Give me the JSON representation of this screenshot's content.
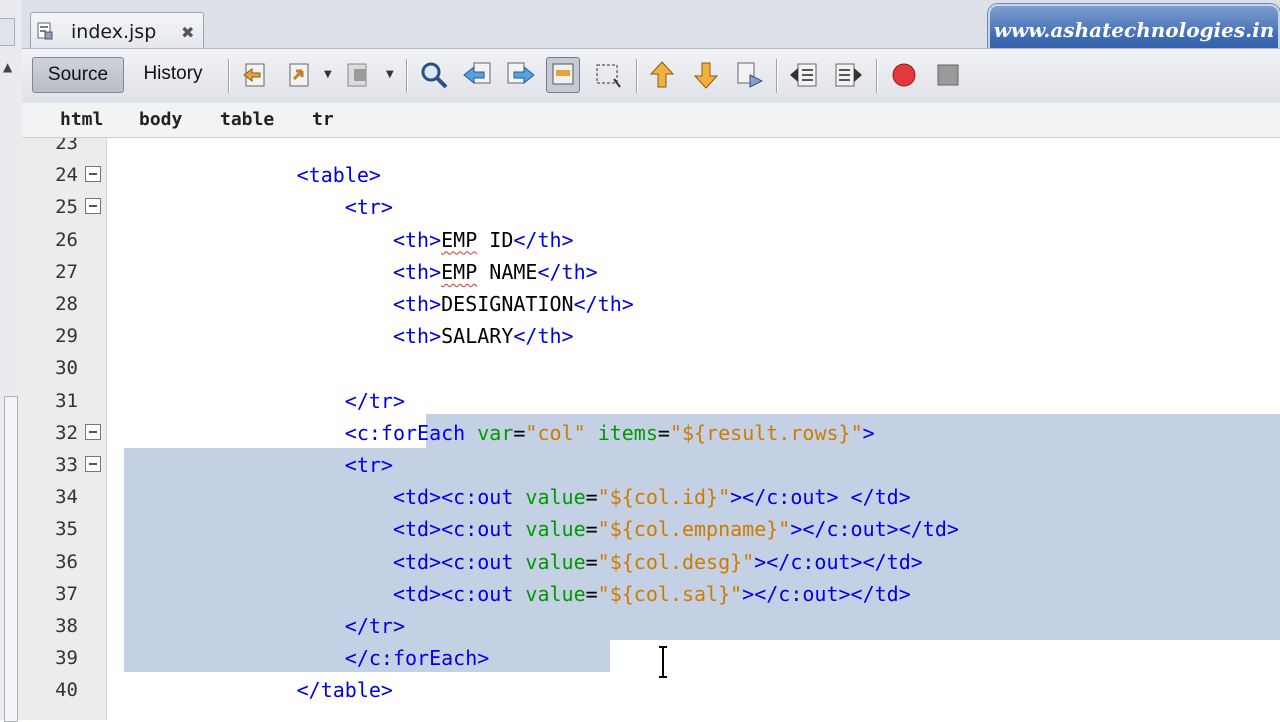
{
  "file_tab": {
    "name": "index.jsp",
    "close_icon": "close-icon"
  },
  "banner": {
    "text": "www.ashatechnologies.in",
    "color": "#3e6bb3"
  },
  "toolbar": {
    "source_label": "Source",
    "history_label": "History"
  },
  "breadcrumbs": [
    "html",
    "body",
    "table",
    "tr"
  ],
  "colors": {
    "tag": "#0000e6",
    "attribute": "#009900",
    "value": "#ce7b00",
    "selection": "#c4d0e4"
  },
  "lines": [
    {
      "n": "23",
      "indent": 0,
      "fold": false,
      "segs": []
    },
    {
      "n": "24",
      "indent": 16,
      "fold": true,
      "segs": [
        {
          "c": "tag",
          "t": "<table>"
        }
      ]
    },
    {
      "n": "25",
      "indent": 20,
      "fold": true,
      "segs": [
        {
          "c": "tag",
          "t": "<tr>"
        }
      ]
    },
    {
      "n": "26",
      "indent": 24,
      "fold": false,
      "segs": [
        {
          "c": "tag",
          "t": "<th>"
        },
        {
          "c": "txt sq",
          "t": "EMP"
        },
        {
          "c": "txt",
          "t": " ID"
        },
        {
          "c": "tag",
          "t": "</th>"
        }
      ]
    },
    {
      "n": "27",
      "indent": 24,
      "fold": false,
      "segs": [
        {
          "c": "tag",
          "t": "<th>"
        },
        {
          "c": "txt sq",
          "t": "EMP"
        },
        {
          "c": "txt",
          "t": " NAME"
        },
        {
          "c": "tag",
          "t": "</th>"
        }
      ]
    },
    {
      "n": "28",
      "indent": 24,
      "fold": false,
      "segs": [
        {
          "c": "tag",
          "t": "<th>"
        },
        {
          "c": "txt",
          "t": "DESIGNATION"
        },
        {
          "c": "tag",
          "t": "</th>"
        }
      ]
    },
    {
      "n": "29",
      "indent": 24,
      "fold": false,
      "segs": [
        {
          "c": "tag",
          "t": "<th>"
        },
        {
          "c": "txt",
          "t": "SALARY"
        },
        {
          "c": "tag",
          "t": "</th>"
        }
      ]
    },
    {
      "n": "30",
      "indent": 0,
      "fold": false,
      "segs": []
    },
    {
      "n": "31",
      "indent": 20,
      "fold": false,
      "segs": [
        {
          "c": "tag",
          "t": "</tr>"
        }
      ]
    },
    {
      "n": "32",
      "indent": 20,
      "fold": true,
      "segs": [
        {
          "c": "tag",
          "t": "<c:forEach "
        },
        {
          "c": "attr",
          "t": "var"
        },
        {
          "c": "txt",
          "t": "="
        },
        {
          "c": "val",
          "t": "\"col\""
        },
        {
          "c": "txt",
          "t": " "
        },
        {
          "c": "attr",
          "t": "items"
        },
        {
          "c": "txt",
          "t": "="
        },
        {
          "c": "val",
          "t": "\"${result.rows}\""
        },
        {
          "c": "tag",
          "t": ">"
        }
      ]
    },
    {
      "n": "33",
      "indent": 20,
      "fold": true,
      "segs": [
        {
          "c": "tag",
          "t": "<tr>"
        }
      ]
    },
    {
      "n": "34",
      "indent": 24,
      "fold": false,
      "segs": [
        {
          "c": "tag",
          "t": "<td><c:out "
        },
        {
          "c": "attr",
          "t": "value"
        },
        {
          "c": "txt",
          "t": "="
        },
        {
          "c": "val",
          "t": "\"${col.id}\""
        },
        {
          "c": "tag",
          "t": "></c:out> </td>"
        }
      ]
    },
    {
      "n": "35",
      "indent": 24,
      "fold": false,
      "segs": [
        {
          "c": "tag",
          "t": "<td><c:out "
        },
        {
          "c": "attr",
          "t": "value"
        },
        {
          "c": "txt",
          "t": "="
        },
        {
          "c": "val",
          "t": "\"${col.empname}\""
        },
        {
          "c": "tag",
          "t": "></c:out></td>"
        }
      ]
    },
    {
      "n": "36",
      "indent": 24,
      "fold": false,
      "segs": [
        {
          "c": "tag",
          "t": "<td><c:out "
        },
        {
          "c": "attr",
          "t": "value"
        },
        {
          "c": "txt",
          "t": "="
        },
        {
          "c": "val",
          "t": "\"${col.desg}\""
        },
        {
          "c": "tag",
          "t": "></c:out></td>"
        }
      ]
    },
    {
      "n": "37",
      "indent": 24,
      "fold": false,
      "segs": [
        {
          "c": "tag",
          "t": "<td><c:out "
        },
        {
          "c": "attr",
          "t": "value"
        },
        {
          "c": "txt",
          "t": "="
        },
        {
          "c": "val",
          "t": "\"${col.sal}\""
        },
        {
          "c": "tag",
          "t": "></c:out></td>"
        }
      ]
    },
    {
      "n": "38",
      "indent": 20,
      "fold": false,
      "segs": [
        {
          "c": "tag",
          "t": "</tr>"
        }
      ]
    },
    {
      "n": "39",
      "indent": 20,
      "fold": false,
      "segs": [
        {
          "c": "tag",
          "t": "</c:forEach>"
        }
      ]
    },
    {
      "n": "40",
      "indent": 16,
      "fold": false,
      "segs": [
        {
          "c": "tag",
          "t": "</table>"
        }
      ]
    }
  ]
}
